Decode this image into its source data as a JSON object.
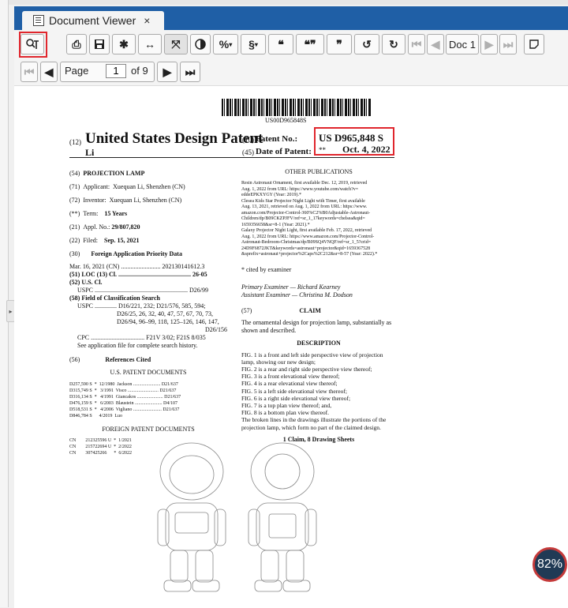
{
  "window": {
    "tab_title": "Document Viewer",
    "tab_close": "×"
  },
  "toolbar": {
    "doc_selector": "Doc 1",
    "icons": [
      "measure-icon",
      "print-icon",
      "save-icon",
      "settings-icon",
      "fit-width-icon",
      "fit-page-icon",
      "contrast-icon",
      "percent-icon",
      "section-icon",
      "quote-icon",
      "quote-alt-icon",
      "quote-close-icon",
      "undo-icon",
      "redo-icon",
      "first-doc-icon",
      "prev-doc-icon",
      "next-doc-icon",
      "last-doc-icon",
      "note-icon"
    ],
    "percent_label": "%",
    "section_label": "§"
  },
  "nav": {
    "page_label": "Page",
    "page_value": "1",
    "of_label": "of 9"
  },
  "patent": {
    "barcode_text": "US00D965848S",
    "country_code": "(12)",
    "title": "United States Design Patent",
    "inventor_short": "Li",
    "patent_no_code": "(10)",
    "patent_no_label": "Patent No.:",
    "patent_no": "US D965,848 S",
    "date_code": "(45)",
    "date_label": "Date of Patent:",
    "date_marker": "**",
    "date": "Oct. 4, 2022",
    "left": [
      {
        "code": "(54)",
        "label": "PROJECTION LAMP"
      },
      {
        "code": "(71)",
        "label": "Applicant:",
        "value": "Xuequan Li, Shenzhen (CN)"
      },
      {
        "code": "(72)",
        "label": "Inventor:",
        "value": "Xuequan Li, Shenzhen (CN)"
      },
      {
        "code": "(**)",
        "label": "Term:",
        "value": "15 Years"
      },
      {
        "code": "(21)",
        "label": "Appl. No.:",
        "value": "29/807,820"
      },
      {
        "code": "(22)",
        "label": "Filed:",
        "value": "Sep. 15, 2021"
      }
    ],
    "priority_code": "(30)",
    "priority_title": "Foreign Application Priority Data",
    "priority_row": "Mar. 16, 2021  (CN) ......................... 202130141612.3",
    "loc_line": "(51) LOC (13) Cl. .............................................. 26-05",
    "uscl_line": "(52) U.S. Cl.",
    "uspc_line": "USPC ........................................................... D26/99",
    "field_line": "(58) Field of Classification Search",
    "field_1": "USPC .............. D16/221, 232; D21/576, 585, 594;",
    "field_2": "D26/25, 26, 32, 40, 47, 57, 67, 70, 73,",
    "field_3": "D26/94, 96–99, 118, 125–126, 146, 147,",
    "field_4": "D26/156",
    "field_5": "CPC .................................. F21V 3/02; F21S 8/035",
    "field_6": "See application file for complete search history.",
    "refs_code": "(56)",
    "refs_title": "References Cited",
    "us_docs_title": "U.S. PATENT DOCUMENTS",
    "us_docs": [
      "D257,590 S  *  12/1980  Jackson ....................... D21/637",
      "D315,749 S  *   3/1991  Visco .......................... D21/637",
      "D316,134 S  *   4/1991  Giancakos ...................... D21/637",
      "D476,159 S  *   6/2003  Blaustein ....................... D4/107",
      "D518,531 S  *   4/2006  Vigliano ........................ D21/637",
      "D846,784 S      4/2019  Luo"
    ],
    "foreign_title": "FOREIGN PATENT DOCUMENTS",
    "foreign_docs": [
      "CN        212325596 U  *  1/2021",
      "CN        215722694 U  *  2/2022",
      "CN        307425266      *  6/2022"
    ],
    "other_pubs_title": "OTHER PUBLICATIONS",
    "other_pubs": [
      "Resin Astronaut Ornament, first available Dec. 12, 2019, retrieved",
      "Aug. 1, 2022 from URL: https://www.youtube.com/watch?v=",
      "eddeEPKXYGY (Year: 2019).*",
      "Clesea Kids Star Projector Night Light with Timer, first available",
      "Aug. 13, 2021, retrieved on Aug. 1, 2022 from URL: https://www.",
      "amazon.com/Projector-Control-360%C2%B0Adjustable-Astronaut-",
      "Children/dp/B09CKZPJFV/ref=sr_1_17keywords=chelsea&qid=",
      "1659356658&sr=8-1 (Year: 2021).*",
      "Galaxy Projector Night Light, first available Feb. 17, 2022, retrieved",
      "Aug. 1, 2022 from URL: https://www.amazon.com/Projector-Control-",
      "Astronaut-Bedroom-Christmas/dp/B09SQ4VNQF/ref=sr_1_5?crid=",
      "24D9F6872JKT&keywords=astronaut+projector&qid=1659367528",
      "&sprefix=astronaut+projector%2Caps%2C212&sr=8-57 (Year: 2022).*"
    ],
    "cited_by": "* cited by examiner",
    "primary_examiner": "Primary Examiner — Richard Kearney",
    "assistant_examiner": "Assistant Examiner — Christina M. Dodson",
    "claim_code": "(57)",
    "claim_title": "CLAIM",
    "claim_text_1": "The ornamental design for projection lamp, substantially as",
    "claim_text_2": "shown and described.",
    "desc_title": "DESCRIPTION",
    "desc": [
      "FIG. 1 is a front and left side perspective view of projection",
      "lamp, showing our new design;",
      "FIG. 2 is a rear and right side perspective view thereof;",
      "FIG. 3 is a front elevational view thereof;",
      "FIG. 4 is a rear elevational view thereof;",
      "FIG. 5 is a left side elevational view thereof;",
      "FIG. 6 is a right side elevational view thereof;",
      "FIG. 7 is a top plan view thereof; and,",
      "FIG. 8 is a bottom plan view thereof.",
      "The broken lines in the drawings illustrate the portions of the",
      "projection lamp, which form no part of the claimed design."
    ],
    "claims_sheets": "1 Claim, 8 Drawing Sheets"
  },
  "zoom": {
    "value": "82%"
  }
}
